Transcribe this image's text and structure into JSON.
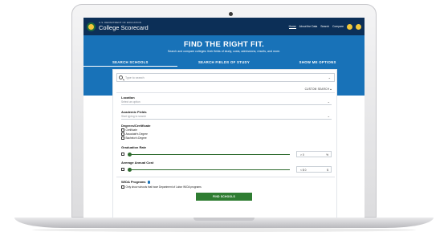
{
  "header": {
    "department": "U.S. DEPARTMENT OF EDUCATION",
    "brand": "College Scorecard",
    "nav": [
      "Home",
      "About the Data",
      "Search",
      "Compare"
    ],
    "icon_colors": [
      "#f3c83a",
      "#f3c83a"
    ]
  },
  "hero": {
    "title": "FIND THE RIGHT FIT.",
    "subtitle": "Search and compare colleges: their fields of study, costs, admissions, results, and more."
  },
  "tabs": [
    "SEARCH SCHOOLS",
    "SEARCH FIELDS OF STUDY",
    "SHOW ME OPTIONS"
  ],
  "form": {
    "search_placeholder": "Type to search",
    "custom_search": "CUSTOM SEARCH",
    "location_label": "Location",
    "location_placeholder": "Select an option",
    "academic_label": "Academic Fields",
    "academic_placeholder": "Start typing to search",
    "degrees_label": "Degrees/Certificate",
    "degrees": [
      "Certificate",
      "Associate's Degree",
      "Bachelor's Degree"
    ],
    "graduation_label": "Graduation Rate",
    "graduation_value": "> 0",
    "graduation_unit": "%",
    "cost_label": "Average Annual Cost",
    "cost_value": "< $ 0",
    "cost_unit": "$",
    "wioa_label": "WIOA Programs",
    "wioa_option": "Only show schools that have Department of Labor WIOA programs",
    "submit": "FIND SCHOOLS"
  },
  "colors": {
    "header_bg": "#0c2f57",
    "hero_bg": "#1872b8",
    "accent_green": "#2f7d32"
  }
}
